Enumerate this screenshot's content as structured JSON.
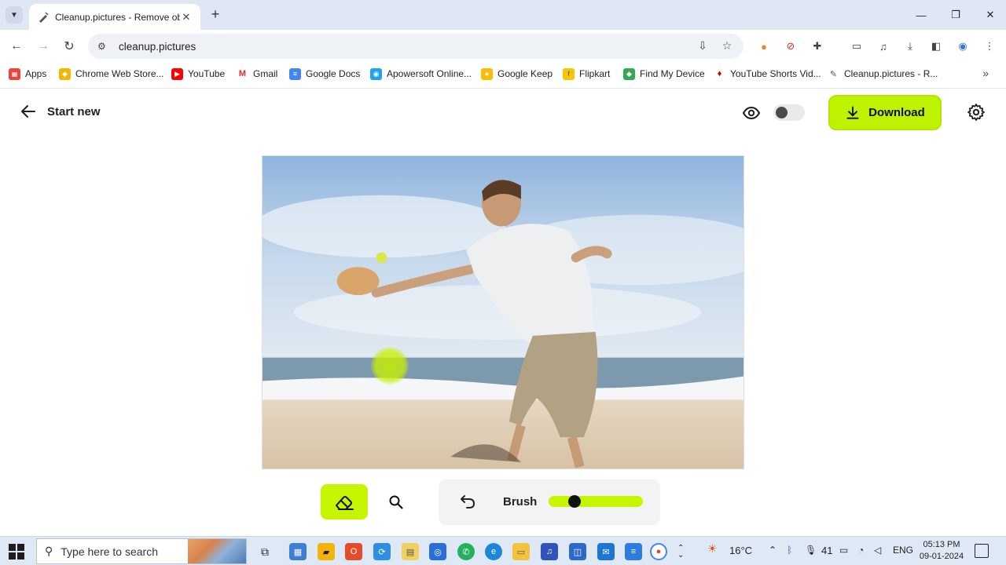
{
  "browser": {
    "tab_title": "Cleanup.pictures - Remove obj",
    "url": "cleanup.pictures",
    "bookmarks": [
      {
        "label": "Apps",
        "color": "#e8453c"
      },
      {
        "label": "Chrome Web Store...",
        "color": "#f4b400"
      },
      {
        "label": "YouTube",
        "color": "#ff0000"
      },
      {
        "label": "Gmail",
        "color": "#d93025"
      },
      {
        "label": "Google Docs",
        "color": "#4285f4"
      },
      {
        "label": "Apowersoft Online...",
        "color": "#1ea1f2"
      },
      {
        "label": "Google Keep",
        "color": "#fbbc04"
      },
      {
        "label": "Flipkart",
        "color": "#f7c600"
      },
      {
        "label": "Find My Device",
        "color": "#34a853"
      },
      {
        "label": "YouTube Shorts Vid...",
        "color": "#cc0000"
      },
      {
        "label": "Cleanup.pictures - R...",
        "color": "#777777"
      }
    ]
  },
  "app": {
    "back_label": "Start new",
    "download_label": "Download",
    "brush_label": "Brush",
    "brush_size_fraction": 0.24,
    "accent_color": "#bdf300",
    "compare_toggle_on": false
  },
  "taskbar": {
    "search_placeholder": "Type here to search",
    "weather": "16°C",
    "volume_value": "41",
    "language": "ENG",
    "time": "05:13 PM",
    "date": "09-01-2024"
  }
}
